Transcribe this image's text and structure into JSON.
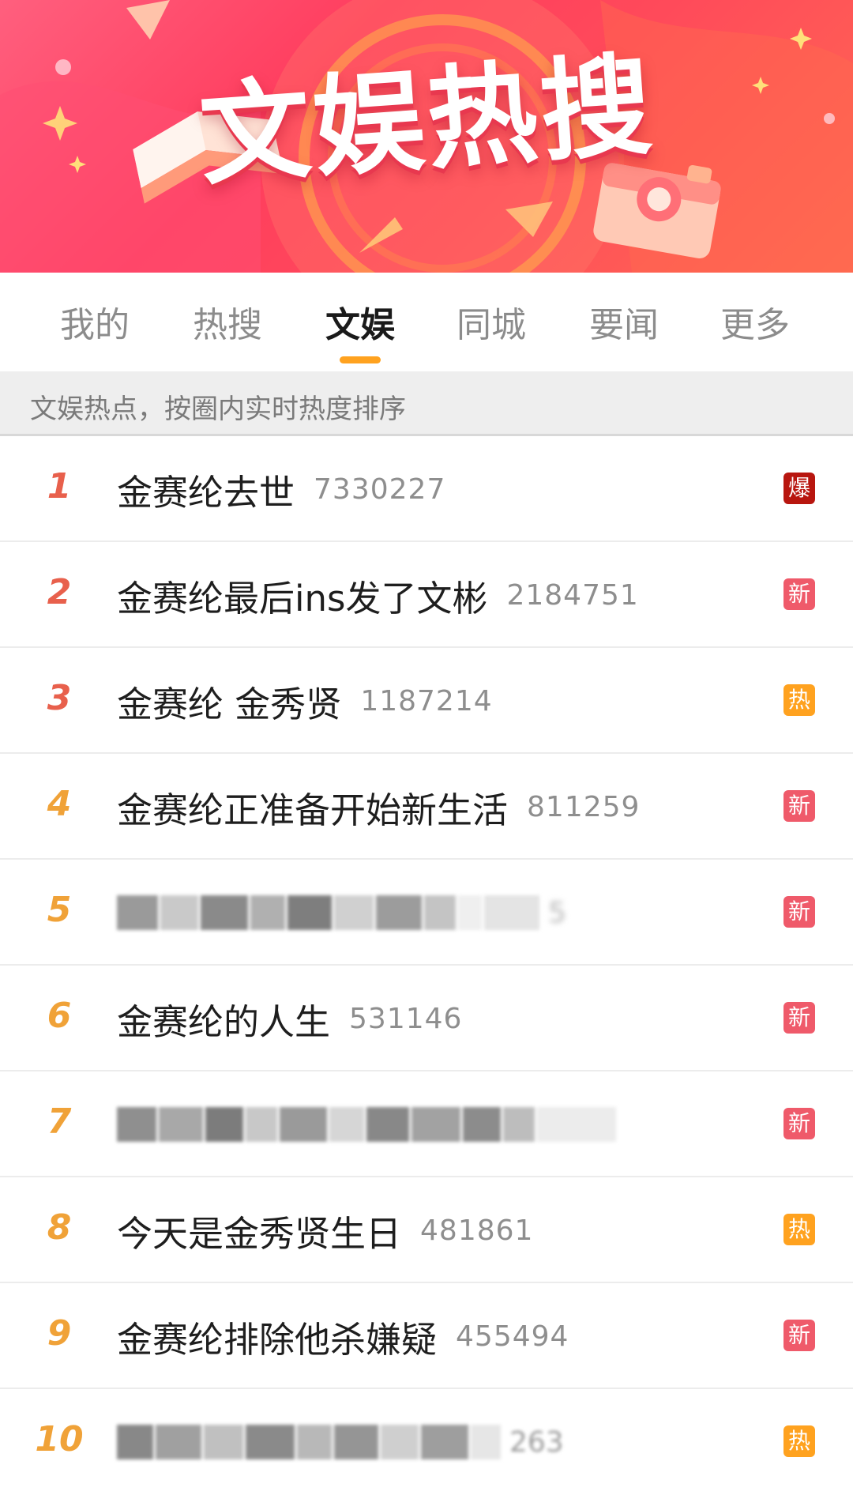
{
  "banner": {
    "title": "文娱热搜"
  },
  "tabs": [
    {
      "label": "我的",
      "active": false
    },
    {
      "label": "热搜",
      "active": false
    },
    {
      "label": "文娱",
      "active": true
    },
    {
      "label": "同城",
      "active": false
    },
    {
      "label": "要闻",
      "active": false
    },
    {
      "label": "更多",
      "active": false
    }
  ],
  "subtitle": "文娱热点，按圈内实时热度排序",
  "colors": {
    "accent_orange": "#ffa21f",
    "badge_explosive": "#b8160f",
    "badge_new": "#ef5a6a",
    "badge_hot": "#ffa21f",
    "rank_top3": "#e8604c",
    "rank_other": "#f0a238"
  },
  "items": [
    {
      "rank": "1",
      "title": "金赛纶去世",
      "count": "7330227",
      "badge": "爆",
      "badge_type": "explosive",
      "blurred": false
    },
    {
      "rank": "2",
      "title": "金赛纶最后ins发了文彬",
      "count": "2184751",
      "badge": "新",
      "badge_type": "new",
      "blurred": false
    },
    {
      "rank": "3",
      "title": "金赛纶 金秀贤",
      "count": "1187214",
      "badge": "热",
      "badge_type": "hot",
      "blurred": false
    },
    {
      "rank": "4",
      "title": "金赛纶正准备开始新生活",
      "count": "811259",
      "badge": "新",
      "badge_type": "new",
      "blurred": false
    },
    {
      "rank": "5",
      "title": "",
      "count": "5",
      "badge": "新",
      "badge_type": "new",
      "blurred": true
    },
    {
      "rank": "6",
      "title": "金赛纶的人生",
      "count": "531146",
      "badge": "新",
      "badge_type": "new",
      "blurred": false
    },
    {
      "rank": "7",
      "title": "",
      "count": "",
      "badge": "新",
      "badge_type": "new",
      "blurred": true
    },
    {
      "rank": "8",
      "title": "今天是金秀贤生日",
      "count": "481861",
      "badge": "热",
      "badge_type": "hot",
      "blurred": false
    },
    {
      "rank": "9",
      "title": "金赛纶排除他杀嫌疑",
      "count": "455494",
      "badge": "新",
      "badge_type": "new",
      "blurred": false
    },
    {
      "rank": "10",
      "title": "",
      "count": "263",
      "badge": "热",
      "badge_type": "hot",
      "blurred": true
    }
  ]
}
